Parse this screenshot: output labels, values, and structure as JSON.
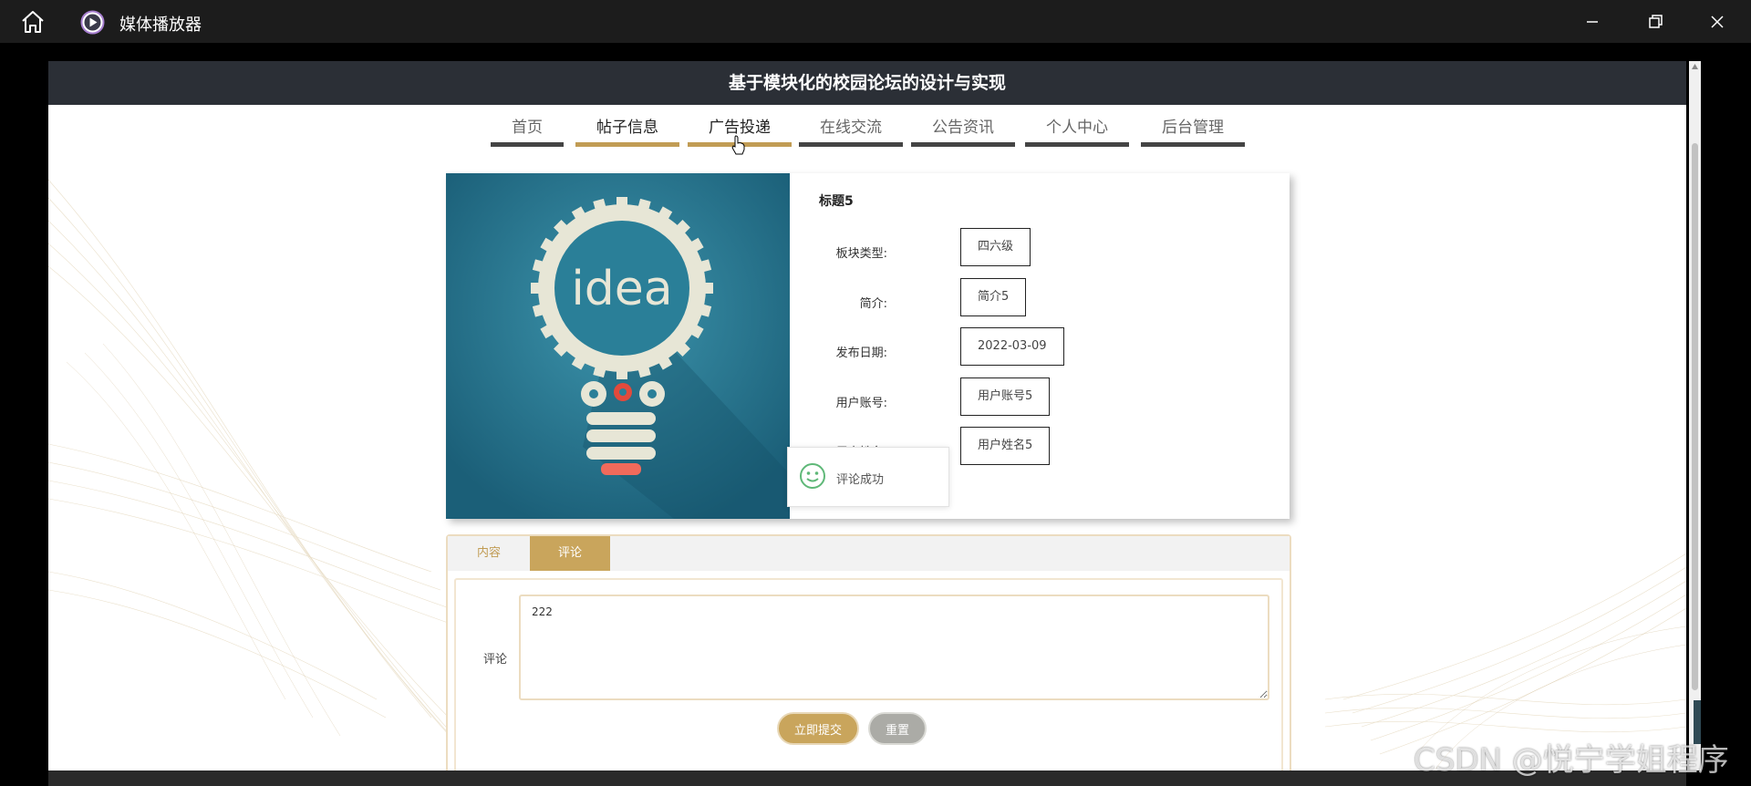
{
  "player": {
    "title": "媒体播放器"
  },
  "site": {
    "title": "基于模块化的校园论坛的设计与实现"
  },
  "nav": {
    "items": [
      "首页",
      "帖子信息",
      "广告投递",
      "在线交流",
      "公告资讯",
      "个人中心",
      "后台管理"
    ],
    "active_items": [
      "帖子信息",
      "广告投递"
    ]
  },
  "post": {
    "title": "标题5",
    "image_text": "idea",
    "fields": [
      {
        "label": "板块类型:",
        "value": "四六级"
      },
      {
        "label": "简介:",
        "value": "简介5"
      },
      {
        "label": "发布日期:",
        "value": "2022-03-09"
      },
      {
        "label": "用户账号:",
        "value": "用户账号5"
      },
      {
        "label": "用户姓名:",
        "value": "用户姓名5"
      }
    ]
  },
  "toast": {
    "text": "评论成功"
  },
  "tabs": {
    "content_label": "内容",
    "comment_label": "评论",
    "selected": "评论"
  },
  "comment": {
    "label": "评论",
    "value": "222",
    "submit_label": "立即提交",
    "reset_label": "重置"
  },
  "watermark": "CSDN @悦宁学姐程序",
  "colors": {
    "accent": "#c9a55c",
    "header_bg": "#2b2f36",
    "player_bg": "#1c1c1c",
    "cover_bg": "#226c86"
  },
  "icons": [
    "home-icon",
    "media-player-icon",
    "minimize-icon",
    "maximize-icon",
    "close-icon",
    "smiley-icon"
  ]
}
